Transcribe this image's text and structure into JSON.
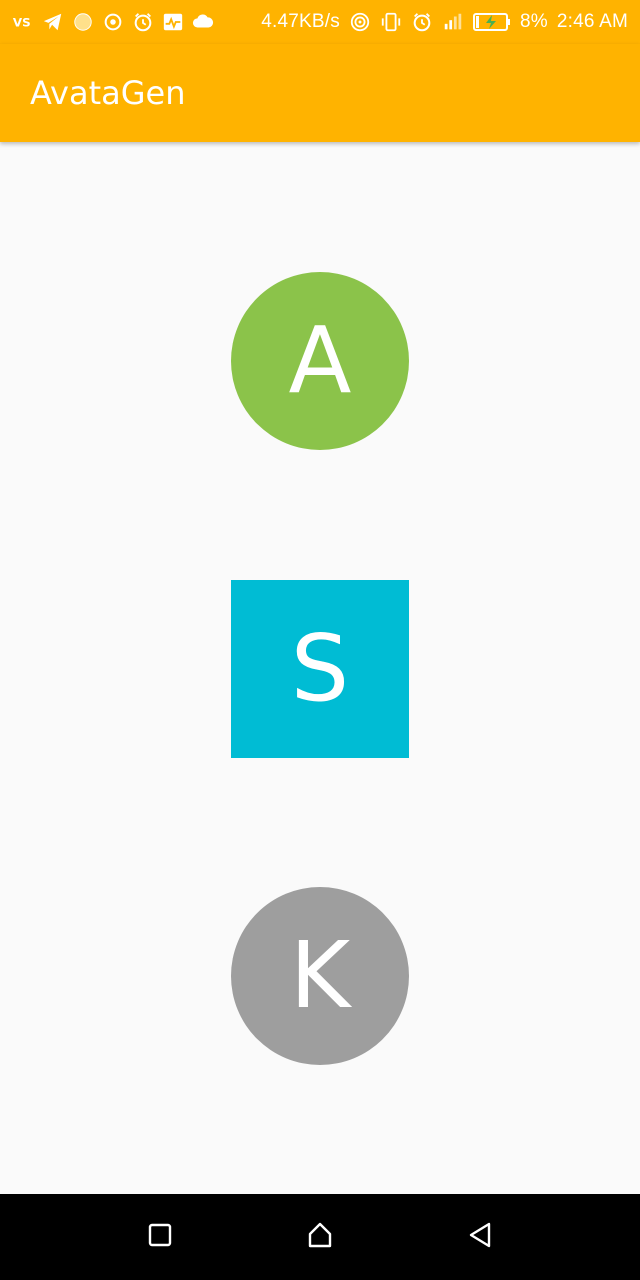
{
  "status_bar": {
    "left_icons": [
      "vpn-icon",
      "telegram-icon",
      "circle-dot-icon",
      "target-icon",
      "alarm-icon",
      "activity-icon",
      "cloud-icon"
    ],
    "network_speed": "4.47KB/s",
    "right_icons": [
      "hotspot-icon",
      "vibrate-icon",
      "alarm-icon",
      "signal-icon",
      "battery-charging-icon"
    ],
    "battery": "8%",
    "time": "2:46 AM"
  },
  "app_bar": {
    "title": "AvataGen",
    "color": "#ffb300"
  },
  "avatars": [
    {
      "letter": "A",
      "shape": "circle",
      "color": "#8bc34a"
    },
    {
      "letter": "S",
      "shape": "square",
      "color": "#00bcd4"
    },
    {
      "letter": "K",
      "shape": "circle",
      "color": "#9e9e9e"
    }
  ],
  "nav_bar": {
    "buttons": [
      "recents-icon",
      "home-icon",
      "back-icon"
    ]
  }
}
